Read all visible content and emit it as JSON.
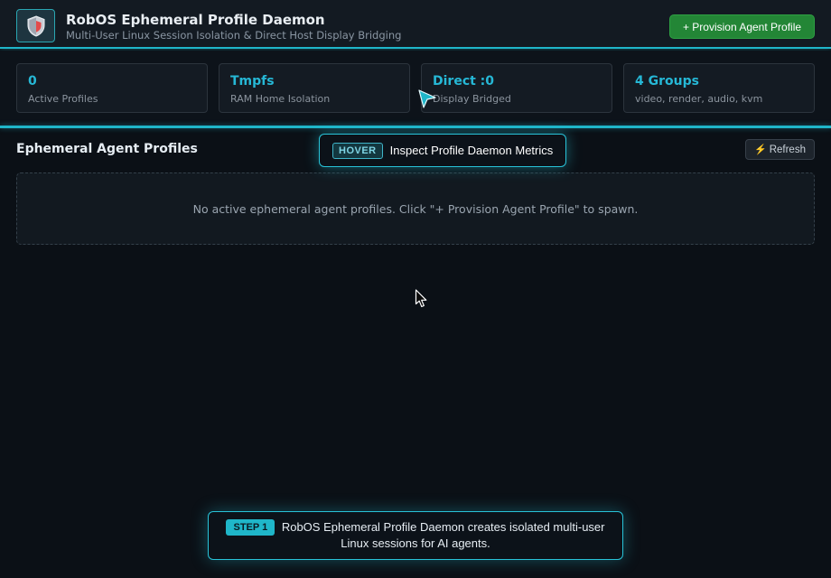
{
  "header": {
    "logo_icon": "shield-icon",
    "title": "RobOS Ephemeral Profile Daemon",
    "subtitle": "Multi-User Linux Session Isolation & Direct Host Display Bridging",
    "provision_label": "+ Provision Agent Profile"
  },
  "stats": [
    {
      "value": "0",
      "label": "Active Profiles"
    },
    {
      "value": "Tmpfs",
      "label": "RAM Home Isolation"
    },
    {
      "value": "Direct :0",
      "label": "Display Bridged"
    },
    {
      "value": "4 Groups",
      "label": "video, render, audio, kvm"
    }
  ],
  "section": {
    "title": "Ephemeral Agent Profiles",
    "refresh_icon": "lightning-icon",
    "refresh_label": "Refresh",
    "empty_message": "No active ephemeral agent profiles. Click \"+ Provision Agent Profile\" to spawn."
  },
  "tooltip": {
    "badge": "HOVER",
    "text": "Inspect Profile Daemon Metrics"
  },
  "step": {
    "badge": "STEP 1",
    "text": "RobOS Ephemeral Profile Daemon creates isolated multi-user Linux sessions for AI agents."
  },
  "colors": {
    "accent": "#1fb6c9",
    "primary_button": "#238636",
    "background": "#0b1016"
  }
}
